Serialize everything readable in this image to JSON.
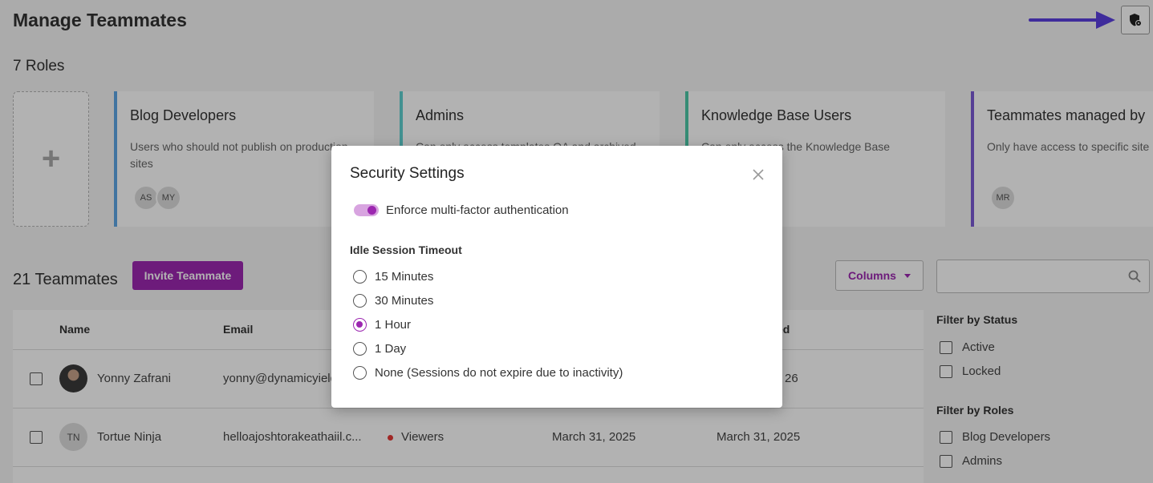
{
  "page": {
    "title": "Manage Teammates"
  },
  "roles": {
    "heading": "7 Roles",
    "add_symbol": "+",
    "cards": [
      {
        "name": "Blog Developers",
        "description": "Users who should not publish on production sites",
        "avatars": [
          "AS",
          "MY"
        ],
        "color": "#5da7e6"
      },
      {
        "name": "Admins",
        "description": "Can only access templates QA and archived",
        "avatars": [],
        "color": "#5fd0d0"
      },
      {
        "name": "Knowledge Base Users",
        "description": "Can only access the Knowledge Base",
        "avatars": [],
        "color": "#4cc9a8"
      },
      {
        "name": "Teammates managed by",
        "description": "Only have access to specific site",
        "avatars": [
          "MR"
        ],
        "color": "#7b5bd6"
      }
    ]
  },
  "teammates": {
    "heading": "21 Teammates",
    "invite_label": "Invite Teammate",
    "columns_label": "Columns",
    "search_placeholder": "",
    "columns": {
      "name": "Name",
      "email": "Email",
      "last_col": "ed"
    },
    "rows": [
      {
        "name": "Yonny Zafrani",
        "initials": "",
        "email": "yonny@dynamicyield",
        "role": "",
        "date1": "",
        "date2": "26"
      },
      {
        "name": "Tortue Ninja",
        "initials": "TN",
        "email": "helloajoshtorakeathaiil.c...",
        "role": "Viewers",
        "date1": "March 31, 2025",
        "date2": "March 31, 2025"
      }
    ]
  },
  "filters": {
    "status_title": "Filter by Status",
    "status_items": [
      "Active",
      "Locked"
    ],
    "roles_title": "Filter by Roles",
    "role_items": [
      "Blog Developers",
      "Admins"
    ]
  },
  "modal": {
    "title": "Security Settings",
    "mfa_label": "Enforce multi-factor authentication",
    "mfa_enabled": true,
    "timeout_label": "Idle Session Timeout",
    "options": [
      "15 Minutes",
      "30 Minutes",
      "1 Hour",
      "1 Day",
      "None (Sessions do not expire due to inactivity)"
    ],
    "selected": "1 Hour"
  },
  "colors": {
    "accent": "#9c27b0",
    "arrow": "#5b3fe0",
    "status_dot": "#e53935"
  }
}
